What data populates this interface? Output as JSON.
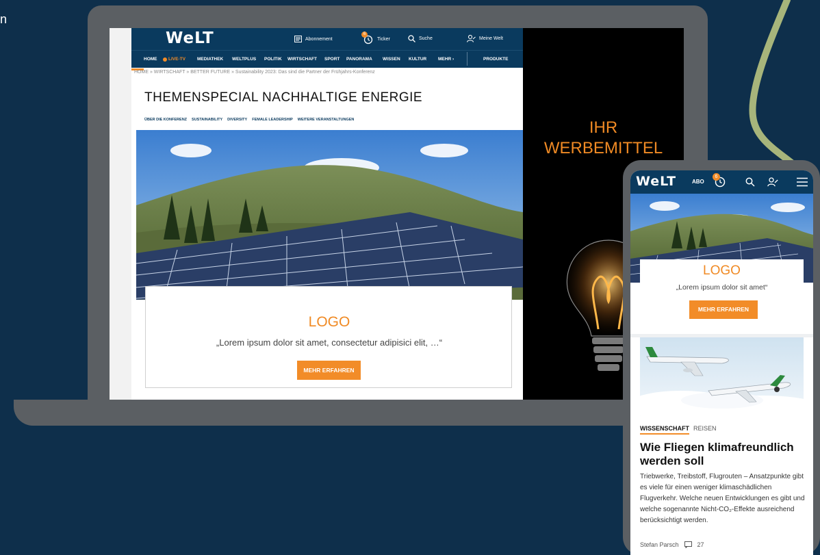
{
  "colors": {
    "background": "#0e2f4b",
    "device_frame": "#5b5f63",
    "welt_blue": "#0a3a5e",
    "accent_orange": "#f28c28",
    "deco_green": "#a7b57b"
  },
  "edge_text": "n",
  "desktop": {
    "logo": "WeLT",
    "topbar": [
      {
        "icon": "newspaper-icon",
        "label": "Abonnement"
      },
      {
        "icon": "ticker-clock-icon",
        "label": "Ticker",
        "badge": "6"
      },
      {
        "icon": "search-icon",
        "label": "Suche"
      },
      {
        "icon": "user-icon",
        "label": "Meine Welt"
      }
    ],
    "nav": [
      "HOME",
      "LIVE-TV",
      "MEDIATHEK",
      "WELTPLUS",
      "POLITIK",
      "WIRTSCHAFT",
      "SPORT",
      "PANORAMA",
      "WISSEN",
      "KULTUR",
      "MEHR ›",
      "PRODUKTE"
    ],
    "breadcrumb": "HOME » WIRTSCHAFT » BETTER FUTURE » Sustainability 2023: Das sind die Partner der Frühjahrs-Konferenz",
    "heading": "THEMENSPECIAL NACHHALTIGE ENERGIE",
    "subnav": [
      "ÜBER DIE KONFERENZ",
      "SUSTAINABILITY",
      "DIVERSITY",
      "FEMALE LEADERSHIP",
      "WEITERE VERANSTALTUNGEN"
    ],
    "card": {
      "logo": "LOGO",
      "quote": "„Lorem ipsum dolor sit amet, consectetur adipisici elit, …“",
      "button": "MEHR ERFAHREN"
    },
    "ad": {
      "line1": "IHR",
      "line2": "WERBEMITTEL"
    }
  },
  "mobile": {
    "logo": "WeLT",
    "abo": "ABO",
    "ticker_badge": "6",
    "card": {
      "logo": "LOGO",
      "quote": "„Lorem ipsum dolor sit amet“",
      "button": "MEHR ERFAHREN"
    },
    "tags": [
      "WISSENSCHAFT",
      "REISEN"
    ],
    "title": "Wie Fliegen klimafreundlich werden soll",
    "body": "Triebwerke, Treibstoff, Flugrouten – Ansatzpunkte gibt es viele für einen weniger klimaschädlichen Flugverkehr. Welche neuen Entwicklungen es gibt und welche sogenannte Nicht-CO₂-Effekte ausreichend berücksichtigt werden.",
    "author": "Stefan Parsch",
    "comments": "27"
  }
}
